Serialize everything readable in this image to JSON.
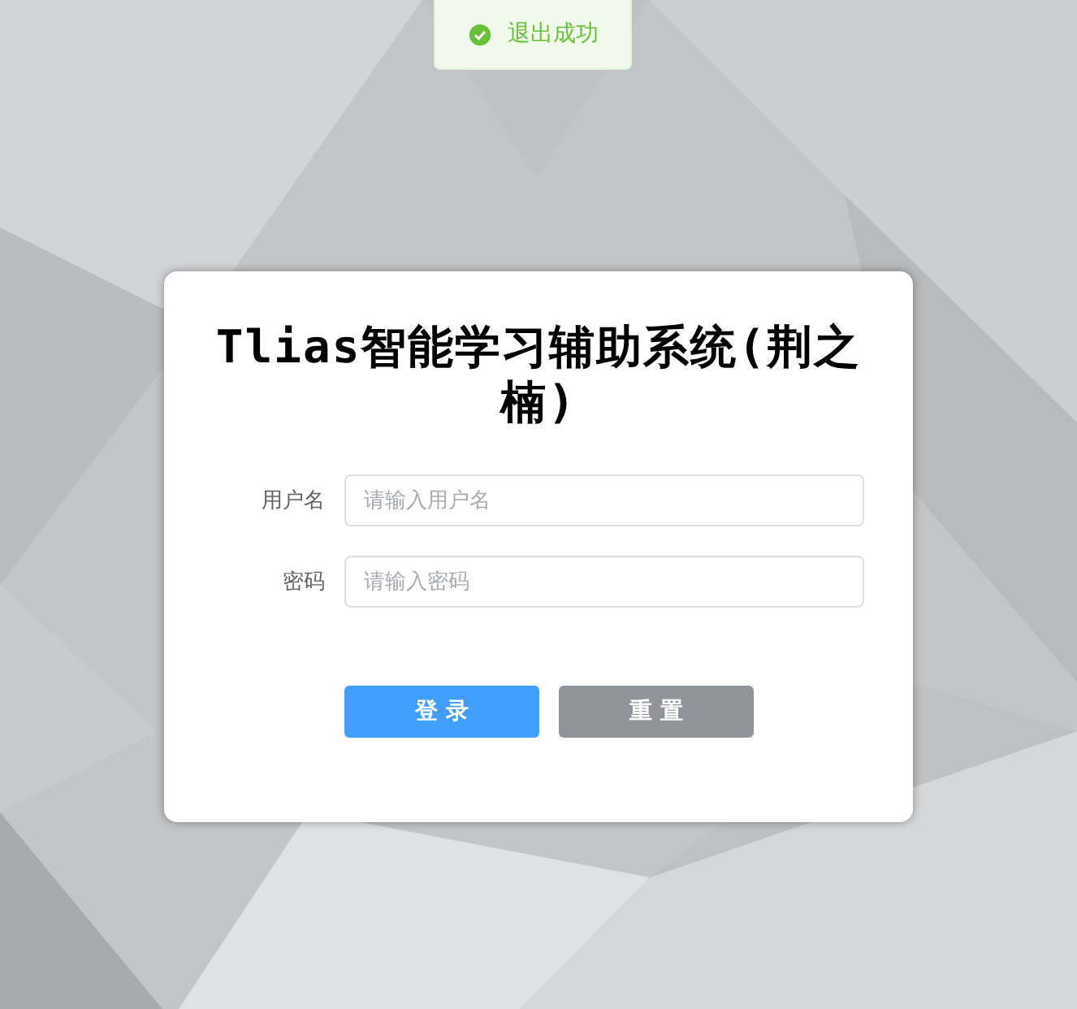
{
  "message": {
    "kind": "success",
    "text": "退出成功"
  },
  "login": {
    "title": "Tlias智能学习辅助系统(荆之楠)",
    "fields": [
      {
        "label": "用户名",
        "placeholder": "请输入用户名"
      },
      {
        "label": "密码",
        "placeholder": "请输入密码"
      }
    ],
    "buttons": [
      {
        "label": "登 录",
        "kind": "primary"
      },
      {
        "label": "重 置",
        "kind": "info"
      }
    ]
  }
}
